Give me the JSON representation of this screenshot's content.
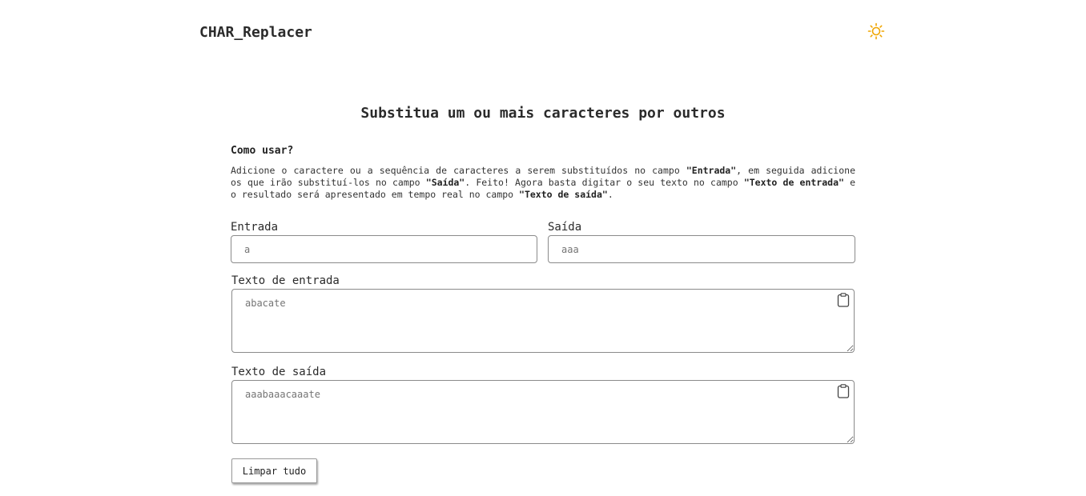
{
  "header": {
    "brand": "CHAR_Replacer",
    "theme_toggle_icon": "sun-icon",
    "accent_color": "#f0a500"
  },
  "main": {
    "title": "Substitua um ou mais caracteres por outros",
    "howto": {
      "title": "Como usar?",
      "parts": [
        "Adicione o caractere ou a sequência de caracteres a serem substituídos no campo ",
        "\"Entrada\"",
        ", em seguida adicione os que irão substituí-los no campo ",
        "\"Saída\"",
        ". Feito! Agora basta digitar o seu texto no campo ",
        "\"Texto de entrada\"",
        " e o resultado será apresentado em tempo real no campo ",
        "\"Texto de saída\"",
        "."
      ]
    },
    "input": {
      "label": "Entrada",
      "placeholder": "a"
    },
    "output": {
      "label": "Saída",
      "placeholder": "aaa"
    },
    "input_text": {
      "label": "Texto de entrada",
      "placeholder": "abacate",
      "copy_icon": "clipboard-icon"
    },
    "output_text": {
      "label": "Texto de saída",
      "placeholder": "aaabaaacaaate",
      "copy_icon": "clipboard-icon"
    },
    "clear_label": "Limpar tudo"
  }
}
